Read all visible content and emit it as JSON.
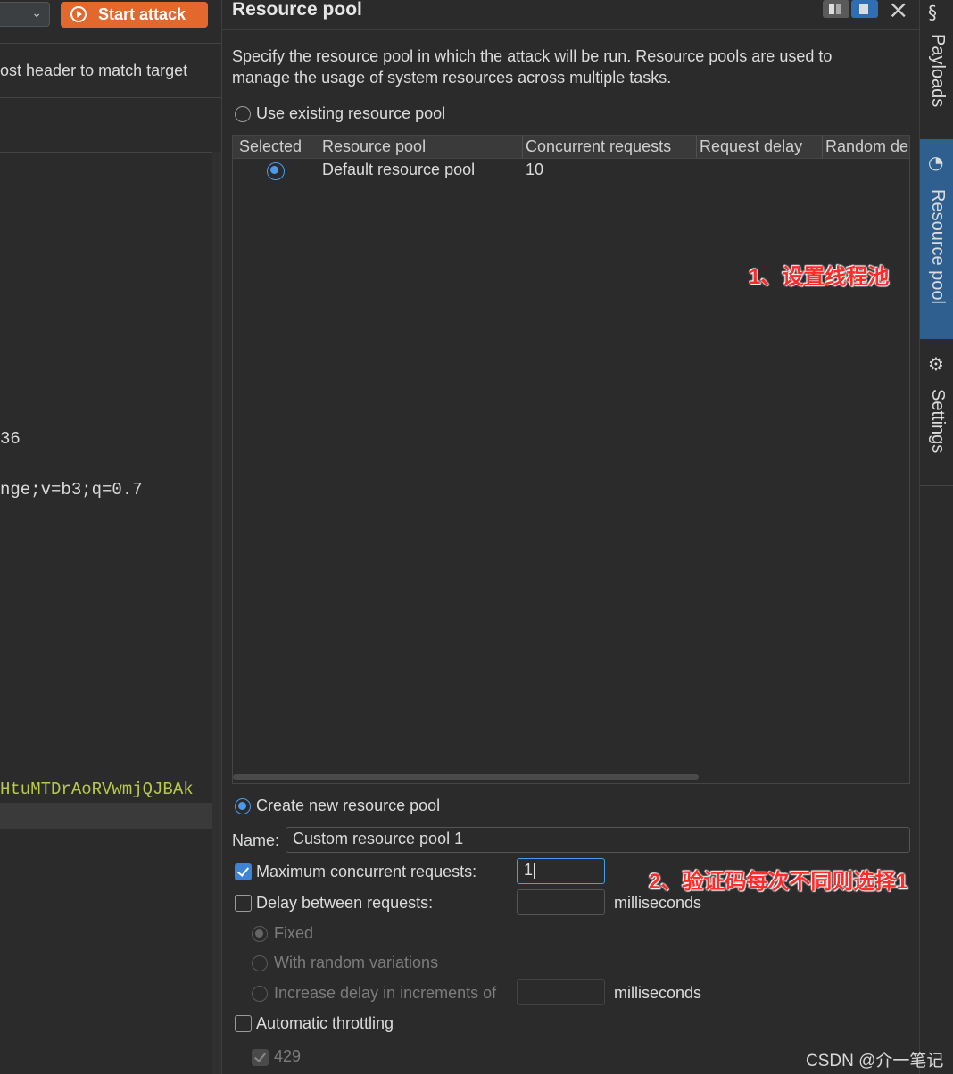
{
  "left": {
    "start_attack_label": "Start attack",
    "host_header_text": "ost header to match target",
    "code_lines": [
      {
        "text": "36",
        "color": "#dcdcdc"
      },
      {
        "text": "nge;v=b3;q=0.7",
        "color": "#dcdcdc"
      },
      {
        "text": "HtuMTDrAoRVwmjQJBAk",
        "color": "#b8c94a"
      }
    ]
  },
  "header": {
    "title": "Resource pool"
  },
  "description": "Specify the resource pool in which the attack will be run. Resource pools are used to manage the usage of system resources across multiple tasks.",
  "use_existing": {
    "label": "Use existing resource pool",
    "selected": false
  },
  "table": {
    "columns": [
      "Selected",
      "Resource pool",
      "Concurrent requests",
      "Request delay",
      "Random de"
    ],
    "rows": [
      {
        "selected": true,
        "resource_pool": "Default resource pool",
        "concurrent_requests": "10",
        "request_delay": "",
        "random_delay": ""
      }
    ]
  },
  "annotations": {
    "a1": "1、设置线程池",
    "a2": "2、验证码每次不同则选择1"
  },
  "create_new": {
    "label": "Create new resource pool",
    "selected": true
  },
  "form": {
    "name_label": "Name:",
    "name_value": "Custom resource pool 1",
    "max_concurrent_label": "Maximum concurrent requests:",
    "max_concurrent_value": "1",
    "max_concurrent_checked": true,
    "delay_label": "Delay between requests:",
    "delay_value": "",
    "ms1": "milliseconds",
    "fixed_label": "Fixed",
    "random_label": "With random variations",
    "increase_label": "Increase delay in increments of",
    "ms2": "milliseconds",
    "throttle_label": "Automatic throttling",
    "code_429": "429"
  },
  "side_tabs": [
    {
      "label": "Payloads",
      "icon": "payloads-icon"
    },
    {
      "label": "Resource pool",
      "icon": "resource-pool-icon",
      "active": true
    },
    {
      "label": "Settings",
      "icon": "gear-icon"
    }
  ],
  "watermark": "CSDN @介一笔记",
  "colors": {
    "accent": "#4a9bf0",
    "start_button": "#e2682d",
    "annotation": "#ff2a2a",
    "active_tab": "#2f5f8f"
  }
}
